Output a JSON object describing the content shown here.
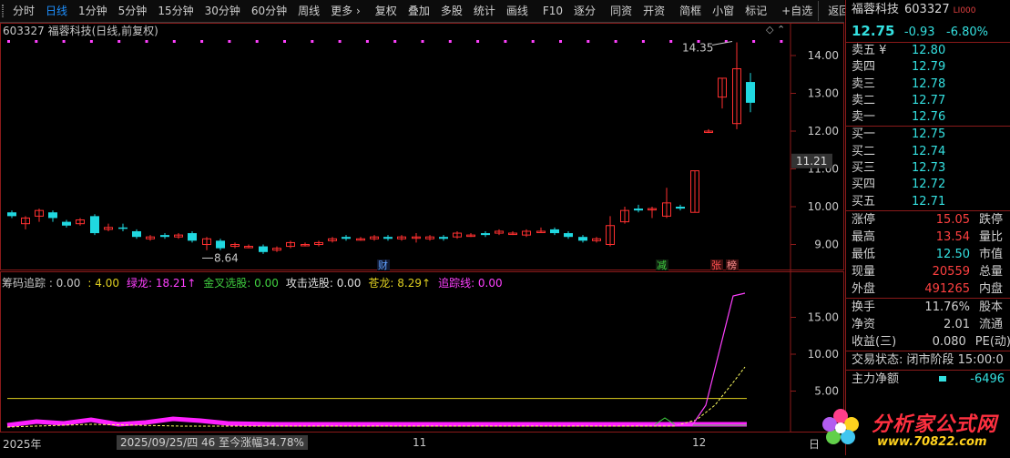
{
  "toolbar": {
    "items": [
      "分时",
      "日线",
      "1分钟",
      "5分钟",
      "15分钟",
      "30分钟",
      "60分钟",
      "周线",
      "更多 ›",
      "复权",
      "叠加",
      "多股",
      "统计",
      "画线",
      "F10",
      "逐分",
      "同资",
      "开资",
      "简框",
      "小窗",
      "标记",
      "+自选",
      "返回"
    ],
    "active_index": 1
  },
  "kline": {
    "title": "603327 福蓉科技(日线,前复权)",
    "high_label": "14.35",
    "low_label": "8.64",
    "crosshair_price": "11.21",
    "y_ticks": [
      "14.00",
      "13.00",
      "12.00",
      "11.00",
      "10.00",
      "9.00"
    ],
    "markers": {
      "cai": "财",
      "jian": "减",
      "zhang": "张",
      "bang": "榜"
    },
    "colors": {
      "up": "#ff3030",
      "down": "#20d8e0"
    }
  },
  "indicator": {
    "title_items": [
      {
        "text": "筹码追踪 : 0.00",
        "color": "#c8c8c8"
      },
      {
        "text": ": 4.00",
        "color": "#e0d020"
      },
      {
        "text": "绿龙: 18.21↑",
        "color": "#ff40ff"
      },
      {
        "text": "金叉选股: 0.00",
        "color": "#40d040"
      },
      {
        "text": "攻击选股: 0.00",
        "color": "#e0e0e0"
      },
      {
        "text": "苍龙: 8.29↑",
        "color": "#e0d020"
      },
      {
        "text": "追踪线: 0.00",
        "color": "#ff40ff"
      }
    ],
    "y_ticks": [
      "15.00",
      "10.00",
      "5.00"
    ]
  },
  "date_axis": {
    "labels": [
      "2025年",
      "11",
      "12",
      "日"
    ],
    "hover": "2025/09/25/四 46 至今涨幅34.78%"
  },
  "quote": {
    "name": "福蓉科技",
    "code": "603327",
    "flag": "LI000",
    "price": "12.75",
    "change": "-0.93",
    "pct": "-6.80%",
    "sell": [
      {
        "label": "卖五 ¥",
        "price": "12.80"
      },
      {
        "label": "卖四",
        "price": "12.79"
      },
      {
        "label": "卖三",
        "price": "12.78"
      },
      {
        "label": "卖二",
        "price": "12.77"
      },
      {
        "label": "卖一",
        "price": "12.76"
      }
    ],
    "buy": [
      {
        "label": "买一",
        "price": "12.75"
      },
      {
        "label": "买二",
        "price": "12.74"
      },
      {
        "label": "买三",
        "price": "12.73"
      },
      {
        "label": "买四",
        "price": "12.72"
      },
      {
        "label": "买五",
        "price": "12.71"
      }
    ],
    "stats": [
      {
        "k": "涨停",
        "v": "15.05",
        "vc": "#ff4040",
        "k2": "跌停"
      },
      {
        "k": "最高",
        "v": "13.54",
        "vc": "#ff4040",
        "k2": "量比"
      },
      {
        "k": "最低",
        "v": "12.50",
        "vc": "#34e0e0",
        "k2": "市值"
      },
      {
        "k": "现量",
        "v": "20559",
        "vc": "#ff4040",
        "k2": "总量"
      },
      {
        "k": "外盘",
        "v": "491265",
        "vc": "#ff4040",
        "k2": "内盘"
      },
      {
        "k": "换手",
        "v": "11.76%",
        "vc": "#d0d0d0",
        "k2": "股本"
      },
      {
        "k": "净资",
        "v": "2.01",
        "vc": "#d0d0d0",
        "k2": "流通"
      },
      {
        "k": "收益(三)",
        "v": "0.080",
        "vc": "#d0d0d0",
        "k2": "PE(动)"
      }
    ],
    "status": "交易状态: 闭市阶段 15:00:0",
    "main_flow_label": "主力净额",
    "main_flow_value": "-6496"
  },
  "logo": {
    "text": "分析家公式网",
    "url": "www.70822.com"
  }
}
